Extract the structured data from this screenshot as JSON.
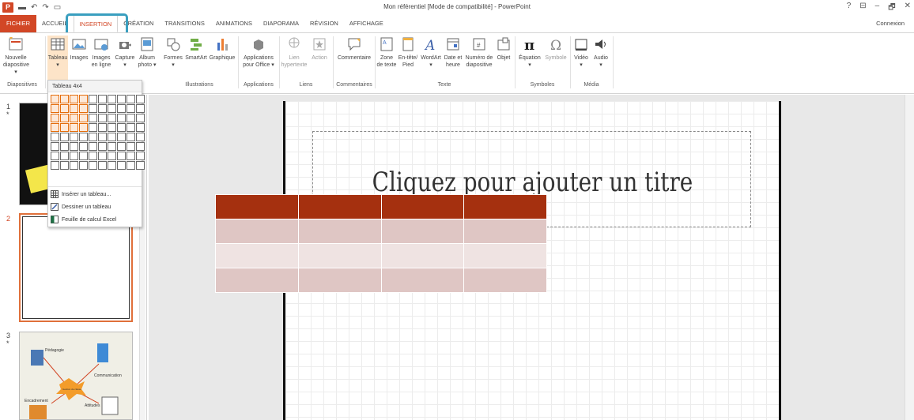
{
  "window": {
    "title": "Mon référentiel [Mode de compatibilité] - PowerPoint",
    "app_logo": "P",
    "controls": [
      "?",
      "⊟",
      "–",
      "🗗",
      "✕"
    ],
    "connexion": "Connexion"
  },
  "qat": [
    "save-icon",
    "undo-icon",
    "redo-icon",
    "start-slideshow-icon"
  ],
  "tabs": [
    {
      "id": "fichier",
      "label": "FICHIER"
    },
    {
      "id": "accueil",
      "label": "ACCUEIL"
    },
    {
      "id": "insertion",
      "label": "INSERTION",
      "active": true
    },
    {
      "id": "creation",
      "label": "CRÉATION"
    },
    {
      "id": "transitions",
      "label": "TRANSITIONS"
    },
    {
      "id": "animations",
      "label": "ANIMATIONS"
    },
    {
      "id": "diaporama",
      "label": "DIAPORAMA"
    },
    {
      "id": "revision",
      "label": "RÉVISION"
    },
    {
      "id": "affichage",
      "label": "AFFICHAGE"
    }
  ],
  "ribbon": {
    "buttons": {
      "nouvelle": {
        "line1": "Nouvelle",
        "line2": "diapositive ▾"
      },
      "tableau": {
        "line1": "Tableau",
        "line2": "▾"
      },
      "images": {
        "line1": "Images",
        "line2": ""
      },
      "images_en_ligne": {
        "line1": "Images",
        "line2": "en ligne"
      },
      "capture": {
        "line1": "Capture",
        "line2": "▾"
      },
      "album": {
        "line1": "Album",
        "line2": "photo ▾"
      },
      "formes": {
        "line1": "Formes",
        "line2": "▾"
      },
      "smartart": {
        "line1": "SmartArt",
        "line2": ""
      },
      "graphique": {
        "line1": "Graphique",
        "line2": ""
      },
      "applications": {
        "line1": "Applications",
        "line2": "pour Office ▾"
      },
      "lien": {
        "line1": "Lien",
        "line2": "hypertexte"
      },
      "action": {
        "line1": "Action",
        "line2": ""
      },
      "commentaire": {
        "line1": "Commentaire",
        "line2": ""
      },
      "zone": {
        "line1": "Zone",
        "line2": "de texte"
      },
      "entete": {
        "line1": "En-tête/",
        "line2": "Pied"
      },
      "wordart": {
        "line1": "WordArt",
        "line2": "▾"
      },
      "date": {
        "line1": "Date et",
        "line2": "heure"
      },
      "numero": {
        "line1": "Numéro de",
        "line2": "diapositive"
      },
      "objet": {
        "line1": "Objet",
        "line2": ""
      },
      "equation": {
        "line1": "Équation",
        "line2": "▾"
      },
      "symbole": {
        "line1": "Symbole",
        "line2": ""
      },
      "video": {
        "line1": "Vidéo",
        "line2": "▾"
      },
      "audio": {
        "line1": "Audio",
        "line2": "▾"
      }
    },
    "groups": {
      "diapositives": "Diapositives",
      "illustrations": "Illustrations",
      "applications": "Applications",
      "liens": "Liens",
      "commentaires": "Commentaires",
      "texte": "Texte",
      "symboles": "Symboles",
      "media": "Média"
    }
  },
  "table_dropdown": {
    "header": "Tableau 4x4",
    "grid": {
      "cols": 10,
      "rows": 8,
      "selected_cols": 4,
      "selected_rows": 4
    },
    "items": [
      {
        "label": "Insérer un tableau...",
        "icon": "insert-table-icon"
      },
      {
        "label": "Dessiner un tableau",
        "icon": "draw-table-icon"
      },
      {
        "label": "Feuille de calcul Excel",
        "icon": "excel-sheet-icon"
      }
    ]
  },
  "slides": [
    {
      "number": "1",
      "marker": "*"
    },
    {
      "number": "2",
      "marker": ""
    },
    {
      "number": "3",
      "marker": "*"
    }
  ],
  "slide3_labels": {
    "pedagogie": "Pédagogie",
    "communication": "Communication",
    "encadrement": "Encadrement",
    "gestion": "Gestion de classe",
    "attitudes": "Attitudes"
  },
  "slide": {
    "title_placeholder": "Cliquez pour ajouter un titre",
    "preview_table": {
      "rows": 4,
      "cols": 4,
      "header_color": "#a5300f",
      "band1": "#dfc6c4",
      "band2": "#efe3e2"
    }
  },
  "colors": {
    "accent": "#d24726",
    "highlight": "#3a9fbf"
  }
}
